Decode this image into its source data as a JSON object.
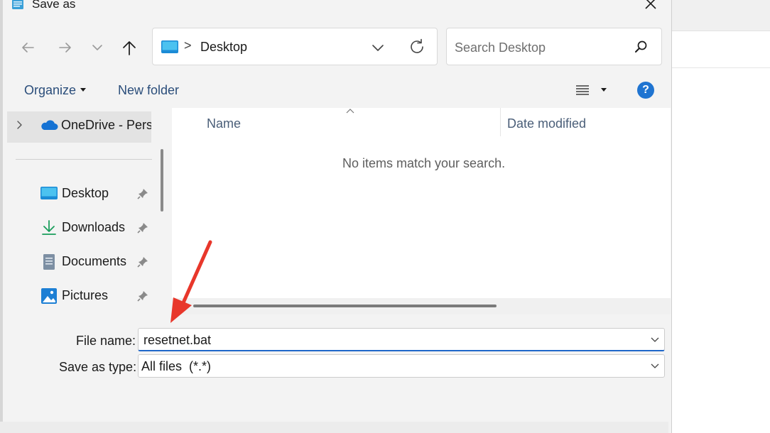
{
  "window": {
    "title": "Save as",
    "close_icon": "close-icon"
  },
  "navigation": {
    "back_icon": "arrow-left-icon",
    "forward_icon": "arrow-right-icon",
    "recent_icon": "chevron-down-icon",
    "up_icon": "arrow-up-icon"
  },
  "address_bar": {
    "location": "Desktop",
    "separator": ">",
    "dropdown_icon": "chevron-down-icon",
    "refresh_icon": "refresh-icon"
  },
  "search": {
    "placeholder": "Search Desktop"
  },
  "toolbar": {
    "organize_label": "Organize",
    "new_folder_label": "New folder",
    "help_label": "?"
  },
  "nav_pane": {
    "onedrive_label": "OneDrive - Personal",
    "quick_access": [
      {
        "label": "Desktop",
        "icon": "desktop-icon"
      },
      {
        "label": "Downloads",
        "icon": "download-icon"
      },
      {
        "label": "Documents",
        "icon": "document-icon"
      },
      {
        "label": "Pictures",
        "icon": "picture-icon"
      }
    ]
  },
  "content": {
    "columns": [
      "Name",
      "Date modified"
    ],
    "empty_message": "No items match your search."
  },
  "form": {
    "file_name_label": "File name:",
    "file_name_value": "resetnet.bat",
    "save_type_label": "Save as type:",
    "save_type_value": "All files  (*.*)"
  },
  "colors": {
    "accent": "#1f74d1",
    "annotation_arrow": "#e8372b",
    "toolbar_text": "#2a4d7a"
  }
}
